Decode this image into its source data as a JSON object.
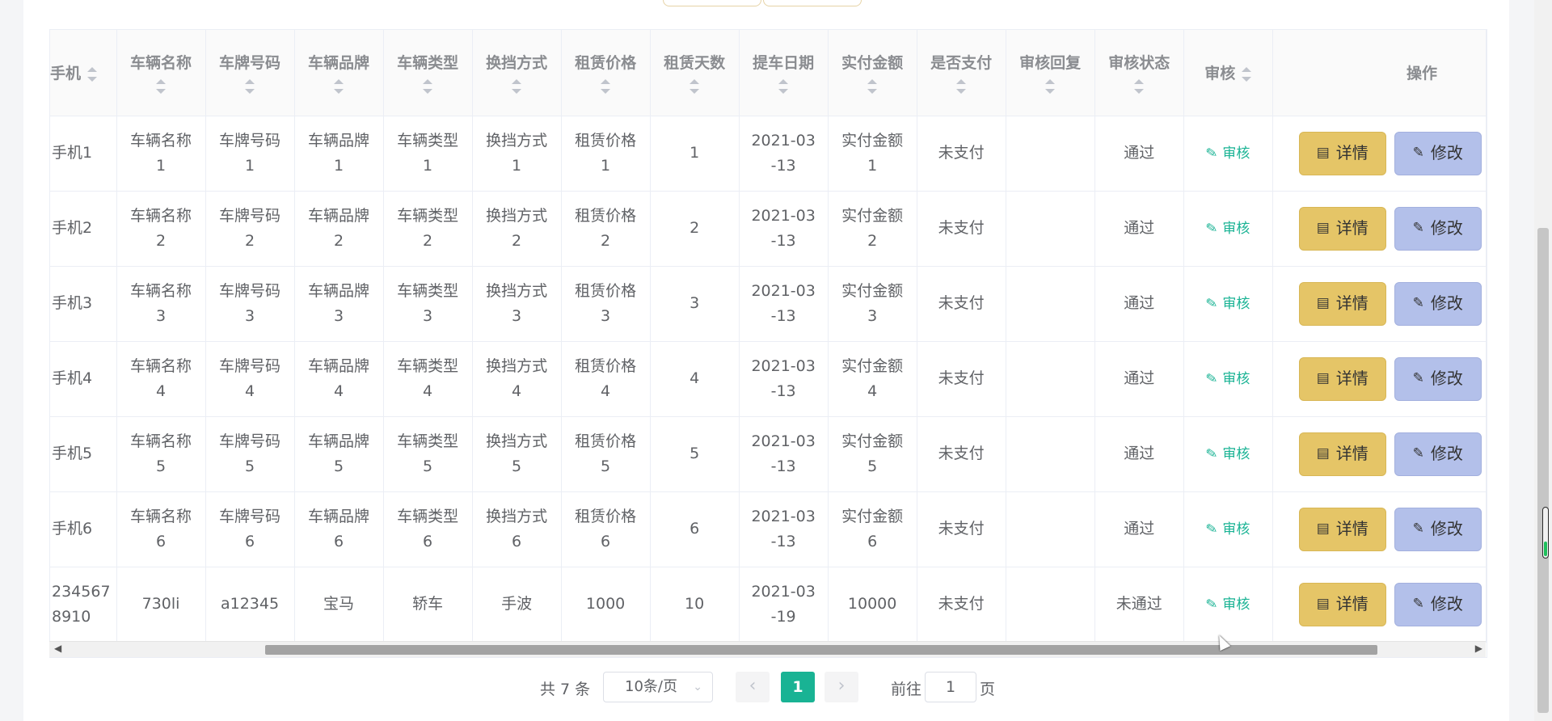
{
  "table": {
    "headers": {
      "phone": "手机",
      "vehicle_name": "车辆名称",
      "plate_no": "车牌号码",
      "brand": "车辆品牌",
      "type": "车辆类型",
      "gearbox": "换挡方式",
      "rent_price": "租赁价格",
      "rent_days": "租赁天数",
      "pickup_date": "提车日期",
      "paid_amount": "实付金额",
      "is_paid": "是否支付",
      "review_reply": "审核回复",
      "review_status": "审核状态",
      "review": "审核",
      "actions": "操作"
    },
    "rows": [
      {
        "phone": "手机1",
        "vehicle_name": "车辆名称\n1",
        "plate_no": "车牌号码\n1",
        "brand": "车辆品牌\n1",
        "type": "车辆类型\n1",
        "gearbox": "换挡方式\n1",
        "rent_price": "租赁价格\n1",
        "rent_days": "1",
        "pickup_date": "2021-03\n-13",
        "paid_amount": "实付金额\n1",
        "is_paid": "未支付",
        "review_reply": "",
        "review_status": "通过"
      },
      {
        "phone": "手机2",
        "vehicle_name": "车辆名称\n2",
        "plate_no": "车牌号码\n2",
        "brand": "车辆品牌\n2",
        "type": "车辆类型\n2",
        "gearbox": "换挡方式\n2",
        "rent_price": "租赁价格\n2",
        "rent_days": "2",
        "pickup_date": "2021-03\n-13",
        "paid_amount": "实付金额\n2",
        "is_paid": "未支付",
        "review_reply": "",
        "review_status": "通过"
      },
      {
        "phone": "手机3",
        "vehicle_name": "车辆名称\n3",
        "plate_no": "车牌号码\n3",
        "brand": "车辆品牌\n3",
        "type": "车辆类型\n3",
        "gearbox": "换挡方式\n3",
        "rent_price": "租赁价格\n3",
        "rent_days": "3",
        "pickup_date": "2021-03\n-13",
        "paid_amount": "实付金额\n3",
        "is_paid": "未支付",
        "review_reply": "",
        "review_status": "通过"
      },
      {
        "phone": "手机4",
        "vehicle_name": "车辆名称\n4",
        "plate_no": "车牌号码\n4",
        "brand": "车辆品牌\n4",
        "type": "车辆类型\n4",
        "gearbox": "换挡方式\n4",
        "rent_price": "租赁价格\n4",
        "rent_days": "4",
        "pickup_date": "2021-03\n-13",
        "paid_amount": "实付金额\n4",
        "is_paid": "未支付",
        "review_reply": "",
        "review_status": "通过"
      },
      {
        "phone": "手机5",
        "vehicle_name": "车辆名称\n5",
        "plate_no": "车牌号码\n5",
        "brand": "车辆品牌\n5",
        "type": "车辆类型\n5",
        "gearbox": "换挡方式\n5",
        "rent_price": "租赁价格\n5",
        "rent_days": "5",
        "pickup_date": "2021-03\n-13",
        "paid_amount": "实付金额\n5",
        "is_paid": "未支付",
        "review_reply": "",
        "review_status": "通过"
      },
      {
        "phone": "手机6",
        "vehicle_name": "车辆名称\n6",
        "plate_no": "车牌号码\n6",
        "brand": "车辆品牌\n6",
        "type": "车辆类型\n6",
        "gearbox": "换挡方式\n6",
        "rent_price": "租赁价格\n6",
        "rent_days": "6",
        "pickup_date": "2021-03\n-13",
        "paid_amount": "实付金额\n6",
        "is_paid": "未支付",
        "review_reply": "",
        "review_status": "通过"
      },
      {
        "phone": "234567\n8910",
        "vehicle_name": "730li",
        "plate_no": "a12345",
        "brand": "宝马",
        "type": "轿车",
        "gearbox": "手波",
        "rent_price": "1000",
        "rent_days": "10",
        "pickup_date": "2021-03\n-19",
        "paid_amount": "10000",
        "is_paid": "未支付",
        "review_reply": "",
        "review_status": "未通过"
      }
    ],
    "audit_link_label": "审核",
    "detail_button_label": "详情",
    "edit_button_label": "修改"
  },
  "pagination": {
    "total_text": "共 7 条",
    "page_size": "10条/页",
    "current_page": "1",
    "goto_label": "前往",
    "goto_value": "1",
    "goto_suffix": "页",
    "prev_icon": "chevron-left-icon",
    "next_icon": "chevron-right-icon"
  },
  "colors": {
    "accent": "#19b394",
    "detail_button": "#e5c567",
    "edit_button": "#b3c0ea"
  }
}
